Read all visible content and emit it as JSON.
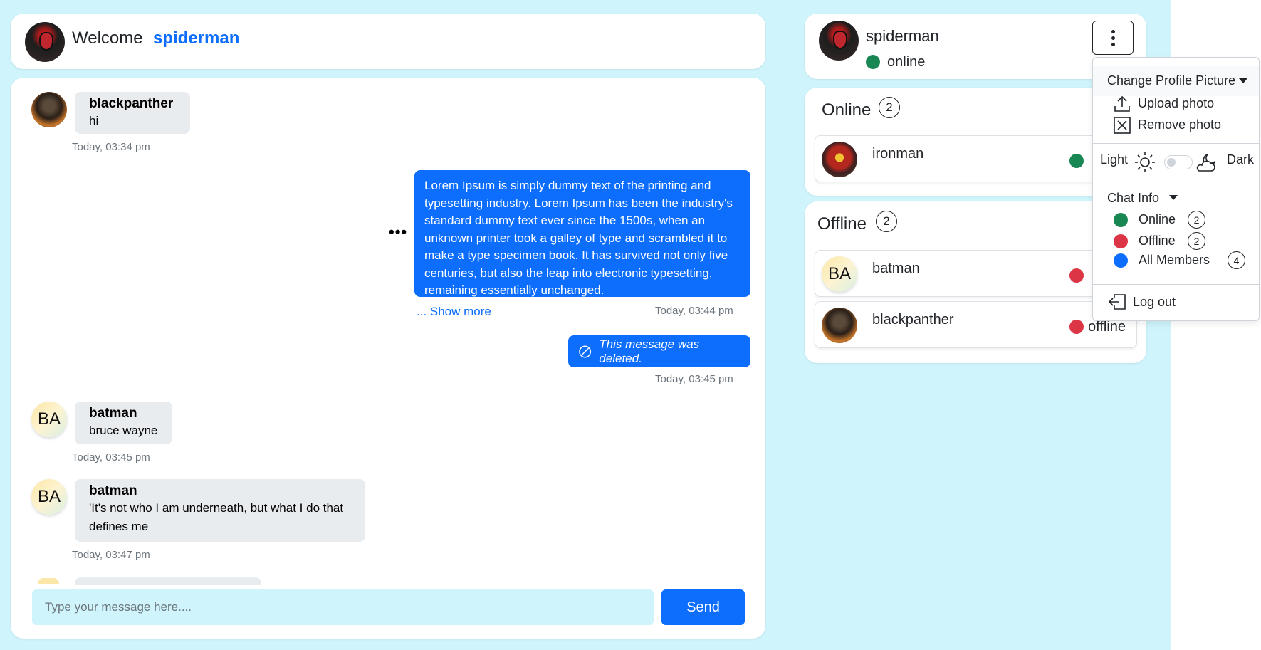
{
  "header": {
    "welcome_label": "Welcome",
    "username": "spiderman"
  },
  "chat": {
    "messages": [
      {
        "sender": "blackpanther",
        "text": "hi",
        "time": "Today, 03:34 pm",
        "direction": "incoming"
      },
      {
        "sender": "spiderman",
        "text": "Lorem Ipsum is simply dummy text of the printing and typesetting industry. Lorem Ipsum has been the industry's standard dummy text ever since the 1500s, when an unknown printer took a galley of type and scrambled it to make a type specimen book. It has survived not only five centuries, but also the leap into electronic typesetting, remaining essentially unchanged.",
        "time": "Today, 03:44 pm",
        "direction": "outgoing",
        "show_more": "... Show more"
      },
      {
        "sender": "spiderman",
        "text": "This message was deleted.",
        "time": "Today, 03:45 pm",
        "direction": "outgoing",
        "deleted": true
      },
      {
        "sender": "batman",
        "initials": "BA",
        "text": "bruce wayne",
        "time": "Today, 03:45 pm",
        "direction": "incoming"
      },
      {
        "sender": "batman",
        "initials": "BA",
        "text": "'It's not who I am underneath, but what I do that defines me",
        "time": "Today, 03:47 pm",
        "direction": "incoming"
      }
    ],
    "input_placeholder": "Type your message here....",
    "send_label": "Send"
  },
  "profile": {
    "name": "spiderman",
    "status": "online"
  },
  "online_section": {
    "title": "Online",
    "count": "2",
    "users": [
      {
        "name": "ironman",
        "status": "online"
      }
    ]
  },
  "offline_section": {
    "title": "Offline",
    "count": "2",
    "users": [
      {
        "name": "batman",
        "initials": "BA",
        "status": "offline"
      },
      {
        "name": "blackpanther",
        "status": "offline"
      }
    ]
  },
  "menu": {
    "change_picture": "Change Profile Picture",
    "upload": "Upload photo",
    "remove": "Remove photo",
    "light": "Light",
    "dark": "Dark",
    "chat_info": "Chat Info",
    "info_items": [
      {
        "label": "Online",
        "count": "2",
        "color": "#198754"
      },
      {
        "label": "Offline",
        "count": "2",
        "color": "#dc3545"
      },
      {
        "label": "All Members",
        "count": "4",
        "color": "#0d6efd"
      }
    ],
    "logout": "Log out"
  },
  "colors": {
    "accent": "#0d6efd",
    "background": "#cff4fc",
    "online": "#198754",
    "offline": "#dc3545"
  }
}
